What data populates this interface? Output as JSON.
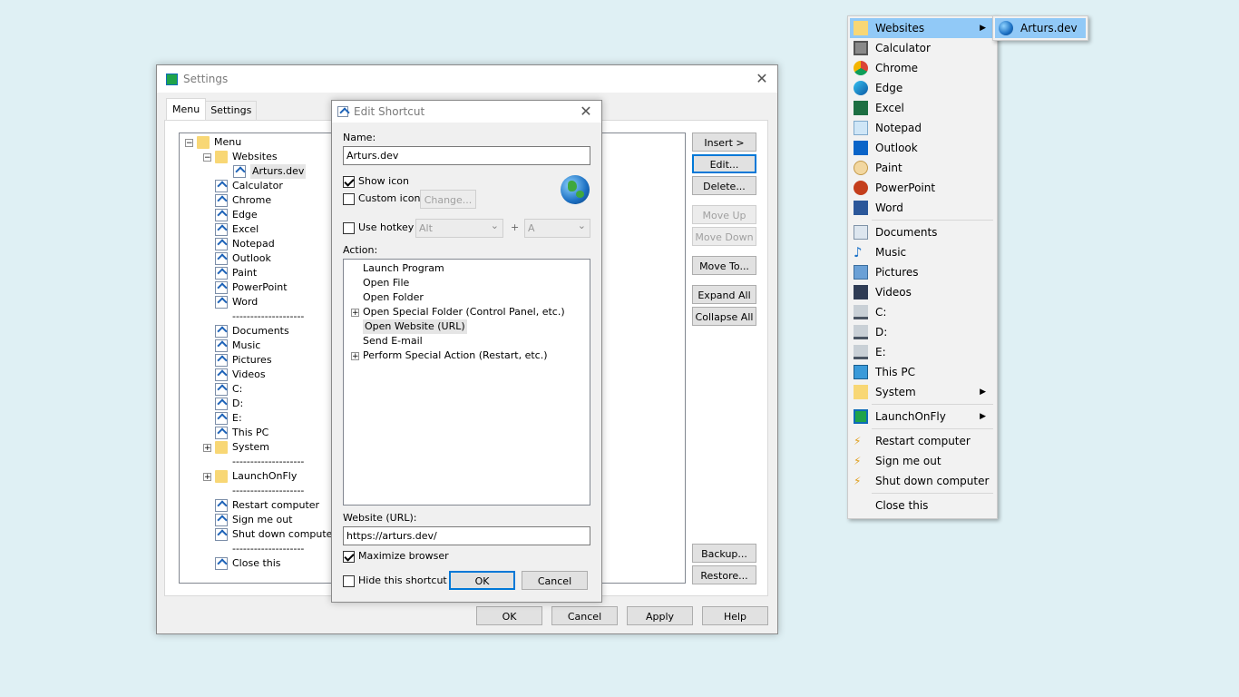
{
  "settings": {
    "title": "Settings",
    "tabs": [
      "Menu",
      "Settings"
    ],
    "tree": [
      {
        "label": "Menu",
        "level": 0,
        "icon": "folder-icon",
        "expander": "-"
      },
      {
        "label": "Websites",
        "level": 1,
        "icon": "folder-icon",
        "expander": "-"
      },
      {
        "label": "Arturs.dev",
        "level": 2,
        "icon": "shortcut-icon",
        "selected": true
      },
      {
        "label": "Calculator",
        "level": 1,
        "icon": "shortcut-icon"
      },
      {
        "label": "Chrome",
        "level": 1,
        "icon": "shortcut-icon"
      },
      {
        "label": "Edge",
        "level": 1,
        "icon": "shortcut-icon"
      },
      {
        "label": "Excel",
        "level": 1,
        "icon": "shortcut-icon"
      },
      {
        "label": "Notepad",
        "level": 1,
        "icon": "shortcut-icon"
      },
      {
        "label": "Outlook",
        "level": 1,
        "icon": "shortcut-icon"
      },
      {
        "label": "Paint",
        "level": 1,
        "icon": "shortcut-icon"
      },
      {
        "label": "PowerPoint",
        "level": 1,
        "icon": "shortcut-icon"
      },
      {
        "label": "Word",
        "level": 1,
        "icon": "shortcut-icon"
      },
      {
        "label": "--------------------",
        "level": 1,
        "icon": "separator"
      },
      {
        "label": "Documents",
        "level": 1,
        "icon": "shortcut-icon"
      },
      {
        "label": "Music",
        "level": 1,
        "icon": "shortcut-icon"
      },
      {
        "label": "Pictures",
        "level": 1,
        "icon": "shortcut-icon"
      },
      {
        "label": "Videos",
        "level": 1,
        "icon": "shortcut-icon"
      },
      {
        "label": "C:",
        "level": 1,
        "icon": "shortcut-icon"
      },
      {
        "label": "D:",
        "level": 1,
        "icon": "shortcut-icon"
      },
      {
        "label": "E:",
        "level": 1,
        "icon": "shortcut-icon"
      },
      {
        "label": "This PC",
        "level": 1,
        "icon": "shortcut-icon"
      },
      {
        "label": "System",
        "level": 1,
        "icon": "folder-icon",
        "expander": "+"
      },
      {
        "label": "--------------------",
        "level": 1,
        "icon": "separator"
      },
      {
        "label": "LaunchOnFly",
        "level": 1,
        "icon": "folder-icon",
        "expander": "+"
      },
      {
        "label": "--------------------",
        "level": 1,
        "icon": "separator"
      },
      {
        "label": "Restart computer",
        "level": 1,
        "icon": "shortcut-icon"
      },
      {
        "label": "Sign me out",
        "level": 1,
        "icon": "shortcut-icon"
      },
      {
        "label": "Shut down computer",
        "level": 1,
        "icon": "shortcut-icon"
      },
      {
        "label": "--------------------",
        "level": 1,
        "icon": "separator"
      },
      {
        "label": "Close this",
        "level": 1,
        "icon": "shortcut-icon"
      }
    ],
    "side_buttons": {
      "insert": "Insert >",
      "edit": "Edit...",
      "delete": "Delete...",
      "move_up": "Move Up",
      "move_down": "Move Down",
      "move_to": "Move To...",
      "expand_all": "Expand All",
      "collapse_all": "Collapse All",
      "backup": "Backup...",
      "restore": "Restore..."
    },
    "bottom_buttons": {
      "ok": "OK",
      "cancel": "Cancel",
      "apply": "Apply",
      "help": "Help"
    }
  },
  "edit_shortcut": {
    "title": "Edit Shortcut",
    "name_label": "Name:",
    "name_value": "Arturs.dev",
    "show_icon_label": "Show icon",
    "show_icon_checked": true,
    "custom_icon_label": "Custom icon",
    "custom_icon_checked": false,
    "change_label": "Change...",
    "use_hotkey_label": "Use hotkey",
    "use_hotkey_checked": false,
    "hotkey_modifier": "Alt",
    "hotkey_plus": "+",
    "hotkey_key": "A",
    "action_label": "Action:",
    "actions": [
      {
        "label": "Launch Program",
        "expander": ""
      },
      {
        "label": "Open File",
        "expander": ""
      },
      {
        "label": "Open Folder",
        "expander": ""
      },
      {
        "label": "Open Special Folder (Control Panel, etc.)",
        "expander": "+"
      },
      {
        "label": "Open Website (URL)",
        "expander": "",
        "selected": true
      },
      {
        "label": "Send E-mail",
        "expander": ""
      },
      {
        "label": "Perform Special Action (Restart, etc.)",
        "expander": "+"
      }
    ],
    "website_label": "Website (URL):",
    "website_value": "https://arturs.dev/",
    "maximize_label": "Maximize browser",
    "maximize_checked": true,
    "hide_label": "Hide this shortcut",
    "hide_checked": false,
    "ok": "OK",
    "cancel": "Cancel"
  },
  "popup_menu": {
    "items": [
      {
        "label": "Websites",
        "icon": "folder-icon",
        "submenu": true,
        "highlighted": true
      },
      {
        "label": "Calculator",
        "icon": "calculator-icon"
      },
      {
        "label": "Chrome",
        "icon": "chrome-icon"
      },
      {
        "label": "Edge",
        "icon": "edge-icon"
      },
      {
        "label": "Excel",
        "icon": "excel-icon"
      },
      {
        "label": "Notepad",
        "icon": "notepad-icon"
      },
      {
        "label": "Outlook",
        "icon": "outlook-icon"
      },
      {
        "label": "Paint",
        "icon": "paint-icon"
      },
      {
        "label": "PowerPoint",
        "icon": "powerpoint-icon"
      },
      {
        "label": "Word",
        "icon": "word-icon"
      },
      {
        "sep": true
      },
      {
        "label": "Documents",
        "icon": "documents-icon"
      },
      {
        "label": "Music",
        "icon": "music-icon"
      },
      {
        "label": "Pictures",
        "icon": "pictures-icon"
      },
      {
        "label": "Videos",
        "icon": "videos-icon"
      },
      {
        "label": "C:",
        "icon": "drive-c-icon"
      },
      {
        "label": "D:",
        "icon": "drive-icon"
      },
      {
        "label": "E:",
        "icon": "drive-icon"
      },
      {
        "label": "This PC",
        "icon": "this-pc-icon"
      },
      {
        "label": "System",
        "icon": "folder-icon",
        "submenu": true
      },
      {
        "sep": true
      },
      {
        "label": "LaunchOnFly",
        "icon": "launchonfly-icon",
        "submenu": true
      },
      {
        "sep": true
      },
      {
        "label": "Restart computer",
        "icon": "lightning-icon"
      },
      {
        "label": "Sign me out",
        "icon": "lightning-icon"
      },
      {
        "label": "Shut down computer",
        "icon": "lightning-icon"
      },
      {
        "sep": true
      },
      {
        "label": "Close this",
        "icon": "none"
      }
    ],
    "submenu_item": {
      "label": "Arturs.dev",
      "icon": "globe-icon"
    }
  },
  "colors": {
    "highlight": "#91c9f7",
    "accent": "#0078d7",
    "folder": "#f8d775"
  }
}
